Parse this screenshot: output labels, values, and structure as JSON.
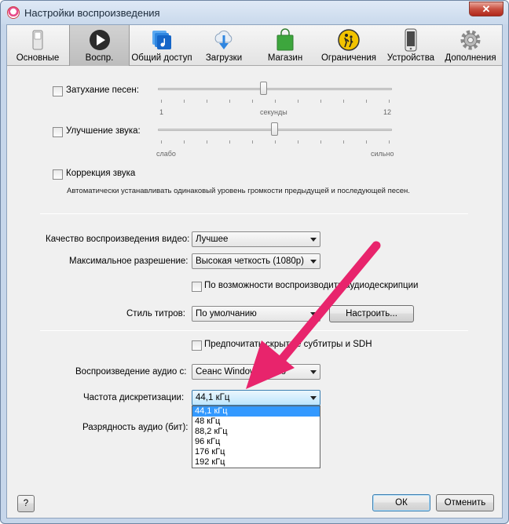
{
  "window": {
    "title": "Настройки воспроизведения",
    "close_label": "✕"
  },
  "tabs": [
    {
      "label": "Основные",
      "icon": "switch-icon"
    },
    {
      "label": "Воспр.",
      "icon": "play-icon",
      "selected": true
    },
    {
      "label": "Общий доступ",
      "icon": "shared-library-icon"
    },
    {
      "label": "Загрузки",
      "icon": "download-cloud-icon"
    },
    {
      "label": "Магазин",
      "icon": "shopping-bag-icon"
    },
    {
      "label": "Ограничения",
      "icon": "parental-restriction-icon"
    },
    {
      "label": "Устройства",
      "icon": "phone-icon"
    },
    {
      "label": "Дополнения",
      "icon": "gear-icon"
    }
  ],
  "crossfade": {
    "label": "Затухание песен:",
    "checked": false,
    "slider_value": 6,
    "scale_min": "1",
    "scale_mid": "секунды",
    "scale_max": "12"
  },
  "sound_enhancer": {
    "label": "Улучшение звука:",
    "checked": false,
    "scale_min": "слабо",
    "scale_max": "сильно"
  },
  "sound_check": {
    "label": "Коррекция звука",
    "checked": false,
    "description": "Автоматически устанавливать одинаковый уровень громкости предыдущей и последующей песен."
  },
  "video_quality": {
    "label": "Качество воспроизведения видео:",
    "value": "Лучшее"
  },
  "max_resolution": {
    "label": "Максимальное разрешение:",
    "value": "Высокая четкость (1080p)"
  },
  "audio_descriptions": {
    "label": "По возможности воспроизводить аудиодескрипции",
    "checked": false
  },
  "subtitle_style": {
    "label": "Стиль титров:",
    "value": "По умолчанию",
    "configure_label": "Настроить..."
  },
  "prefer_subtitles": {
    "label": "Предпочитать скрытые субтитры и SDH",
    "checked": false
  },
  "audio_output": {
    "label": "Воспроизведение аудио с:",
    "value": "Сеанс Windows Audio"
  },
  "sample_rate": {
    "label": "Частота дискретизации:",
    "value": "44,1 кГц",
    "options": [
      "44,1 кГц",
      "48 кГц",
      "88,2 кГц",
      "96 кГц",
      "176 кГц",
      "192 кГц"
    ],
    "selected_index": 0
  },
  "bit_depth": {
    "label": "Разрядность аудио (бит):"
  },
  "footer": {
    "help_label": "?",
    "ok_label": "ОК",
    "cancel_label": "Отменить"
  },
  "colors": {
    "accent": "#3399ff",
    "annotation_arrow": "#e8246c"
  }
}
